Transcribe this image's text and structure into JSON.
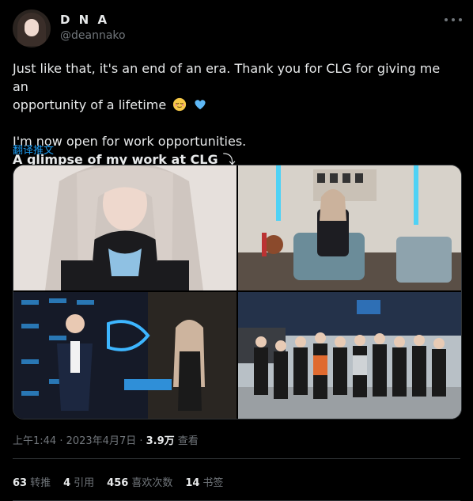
{
  "user": {
    "name": "D N A",
    "handle": "@deannako"
  },
  "tweet": {
    "line1": "Just like that, it's an end of an era. Thank you for CLG for giving me an",
    "line2": "opportunity of a lifetime",
    "line3": "I'm now open for work opportunities.",
    "line4": "A glimpse of my work at CLG",
    "arrow": "⤵",
    "translate": "翻译推文"
  },
  "meta": {
    "time": "上午1:44 · 2023年4月7日 · ",
    "views": "3.9万",
    "views_label": " 查看"
  },
  "stats": [
    {
      "count": "63",
      "label": "转推"
    },
    {
      "count": "4",
      "label": "引用"
    },
    {
      "count": "456",
      "label": "喜欢次数"
    },
    {
      "count": "14",
      "label": "书签"
    }
  ],
  "colors": {
    "bg": "#000000",
    "text": "#e7e9ea",
    "muted": "#71767b",
    "link": "#1d9bf0",
    "divider": "#2f3336"
  },
  "icons": [
    "more-icon",
    "relieved-face-emoji",
    "blue-heart-emoji",
    "arrow-down-right-icon"
  ]
}
